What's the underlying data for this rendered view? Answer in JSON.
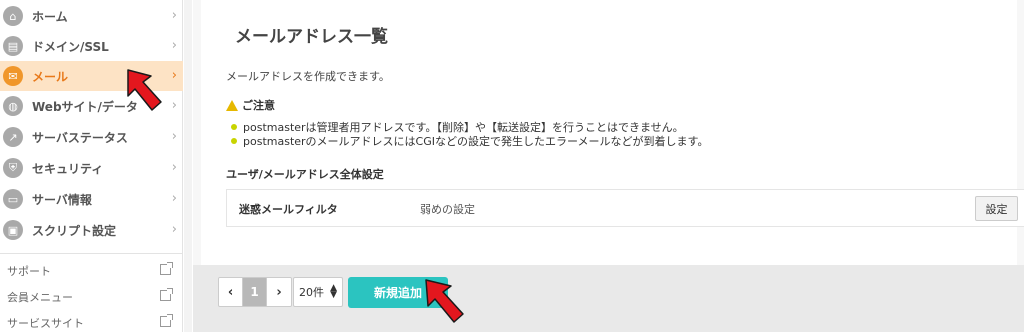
{
  "sidebar": {
    "items": [
      {
        "label": "ホーム",
        "icon": "home-icon",
        "glyph": "⌂"
      },
      {
        "label": "ドメイン/SSL",
        "icon": "domain-icon",
        "glyph": "▤"
      },
      {
        "label": "メール",
        "icon": "mail-icon",
        "glyph": "✉",
        "active": true
      },
      {
        "label": "Webサイト/データ",
        "icon": "web-icon",
        "glyph": "◍"
      },
      {
        "label": "サーバステータス",
        "icon": "chart-icon",
        "glyph": "↗"
      },
      {
        "label": "セキュリティ",
        "icon": "shield-icon",
        "glyph": "⛨"
      },
      {
        "label": "サーバ情報",
        "icon": "server-icon",
        "glyph": "▭"
      },
      {
        "label": "スクリプト設定",
        "icon": "script-icon",
        "glyph": "▣"
      }
    ],
    "sub_items": [
      {
        "label": "サポート"
      },
      {
        "label": "会員メニュー"
      },
      {
        "label": "サービスサイト"
      }
    ],
    "active_color": "#f0962a"
  },
  "main": {
    "title": "メールアドレス一覧",
    "description": "メールアドレスを作成できます。",
    "notice": {
      "heading": "ご注意",
      "lines": [
        "postmasterは管理者用アドレスです。【削除】や【転送設定】を行うことはできません。",
        "postmasterのメールアドレスにはCGIなどの設定で発生したエラーメールなどが到着します。"
      ]
    },
    "settings_section": {
      "heading": "ユーザ/メールアドレス全体設定",
      "row_label": "迷惑メールフィルタ",
      "row_value": "弱めの設定",
      "button_label": "設定"
    }
  },
  "footer": {
    "prev": "‹",
    "current_page": "1",
    "next": "›",
    "per_page": "20件",
    "add_button": "新規追加",
    "accent_color": "#2bc4c0"
  }
}
